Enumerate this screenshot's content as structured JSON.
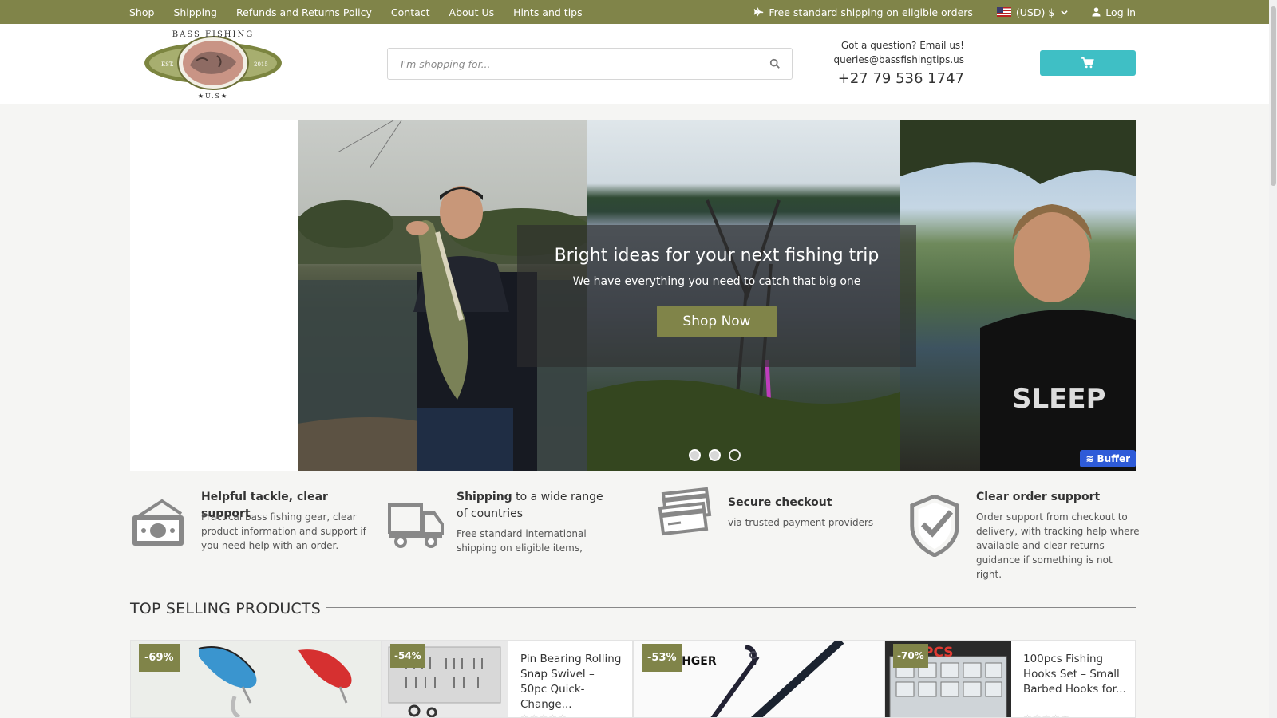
{
  "topbar": {
    "nav": [
      "Shop",
      "Shipping",
      "Refunds and Returns Policy",
      "Contact",
      "About Us",
      "Hints and tips"
    ],
    "shipping_notice": "Free standard shipping on eligible orders",
    "currency": "(USD) $",
    "login": "Log in"
  },
  "header": {
    "logo": {
      "top": "BASS FISHING",
      "left": "EST.",
      "right": "2015",
      "bottom": "★U.S★"
    },
    "search_placeholder": "I'm shopping for...",
    "contact_question": "Got a question? Email us!",
    "contact_email": "queries@bassfishingtips.us",
    "contact_phone": "+27 79 536 1747"
  },
  "banner": {
    "heading": "Bright ideas for your next fishing trip",
    "subheading": "We have everything you need to catch that big one",
    "cta": "Shop Now",
    "slides": 3,
    "active_slide": 3,
    "buffer_label": "Buffer"
  },
  "features": [
    {
      "icon": "money-icon",
      "title": "Helpful tackle, clear support",
      "title_rest": "",
      "desc": "Practical bass fishing gear, clear product information and support if you need help with an order."
    },
    {
      "icon": "truck-icon",
      "title": "Shipping",
      "title_rest": " to a wide range of countries",
      "desc": "Free standard international shipping on eligible items,"
    },
    {
      "icon": "credit-card-icon",
      "title": "Secure checkout",
      "title_rest": "",
      "desc": "via trusted payment providers"
    },
    {
      "icon": "shield-check-icon",
      "title": "Clear order support",
      "title_rest": "",
      "desc": "Order support from checkout to delivery, with tracking help where available and clear returns guidance if something is not right."
    }
  ],
  "section_title": "TOP SELLING PRODUCTS",
  "products": [
    {
      "discount": "-69%",
      "title": "",
      "image": "fishing-lures"
    },
    {
      "discount": "-54%",
      "title": "Pin Bearing Rolling Snap Swivel – 50pc Quick-Change...",
      "image": "snap-swivels"
    },
    {
      "discount": "-53%",
      "title": "",
      "image": "fishing-rod",
      "brand_text": "SHGER"
    },
    {
      "discount": "-70%",
      "title": "100pcs Fishing Hooks Set – Small Barbed Hooks for...",
      "image": "hooks-box",
      "brand_text": "PCS"
    }
  ],
  "colors": {
    "topbar": "#808449",
    "accent_olive": "#808449",
    "cart_button": "#3fbfc5",
    "buffer": "#2e5bd8"
  }
}
